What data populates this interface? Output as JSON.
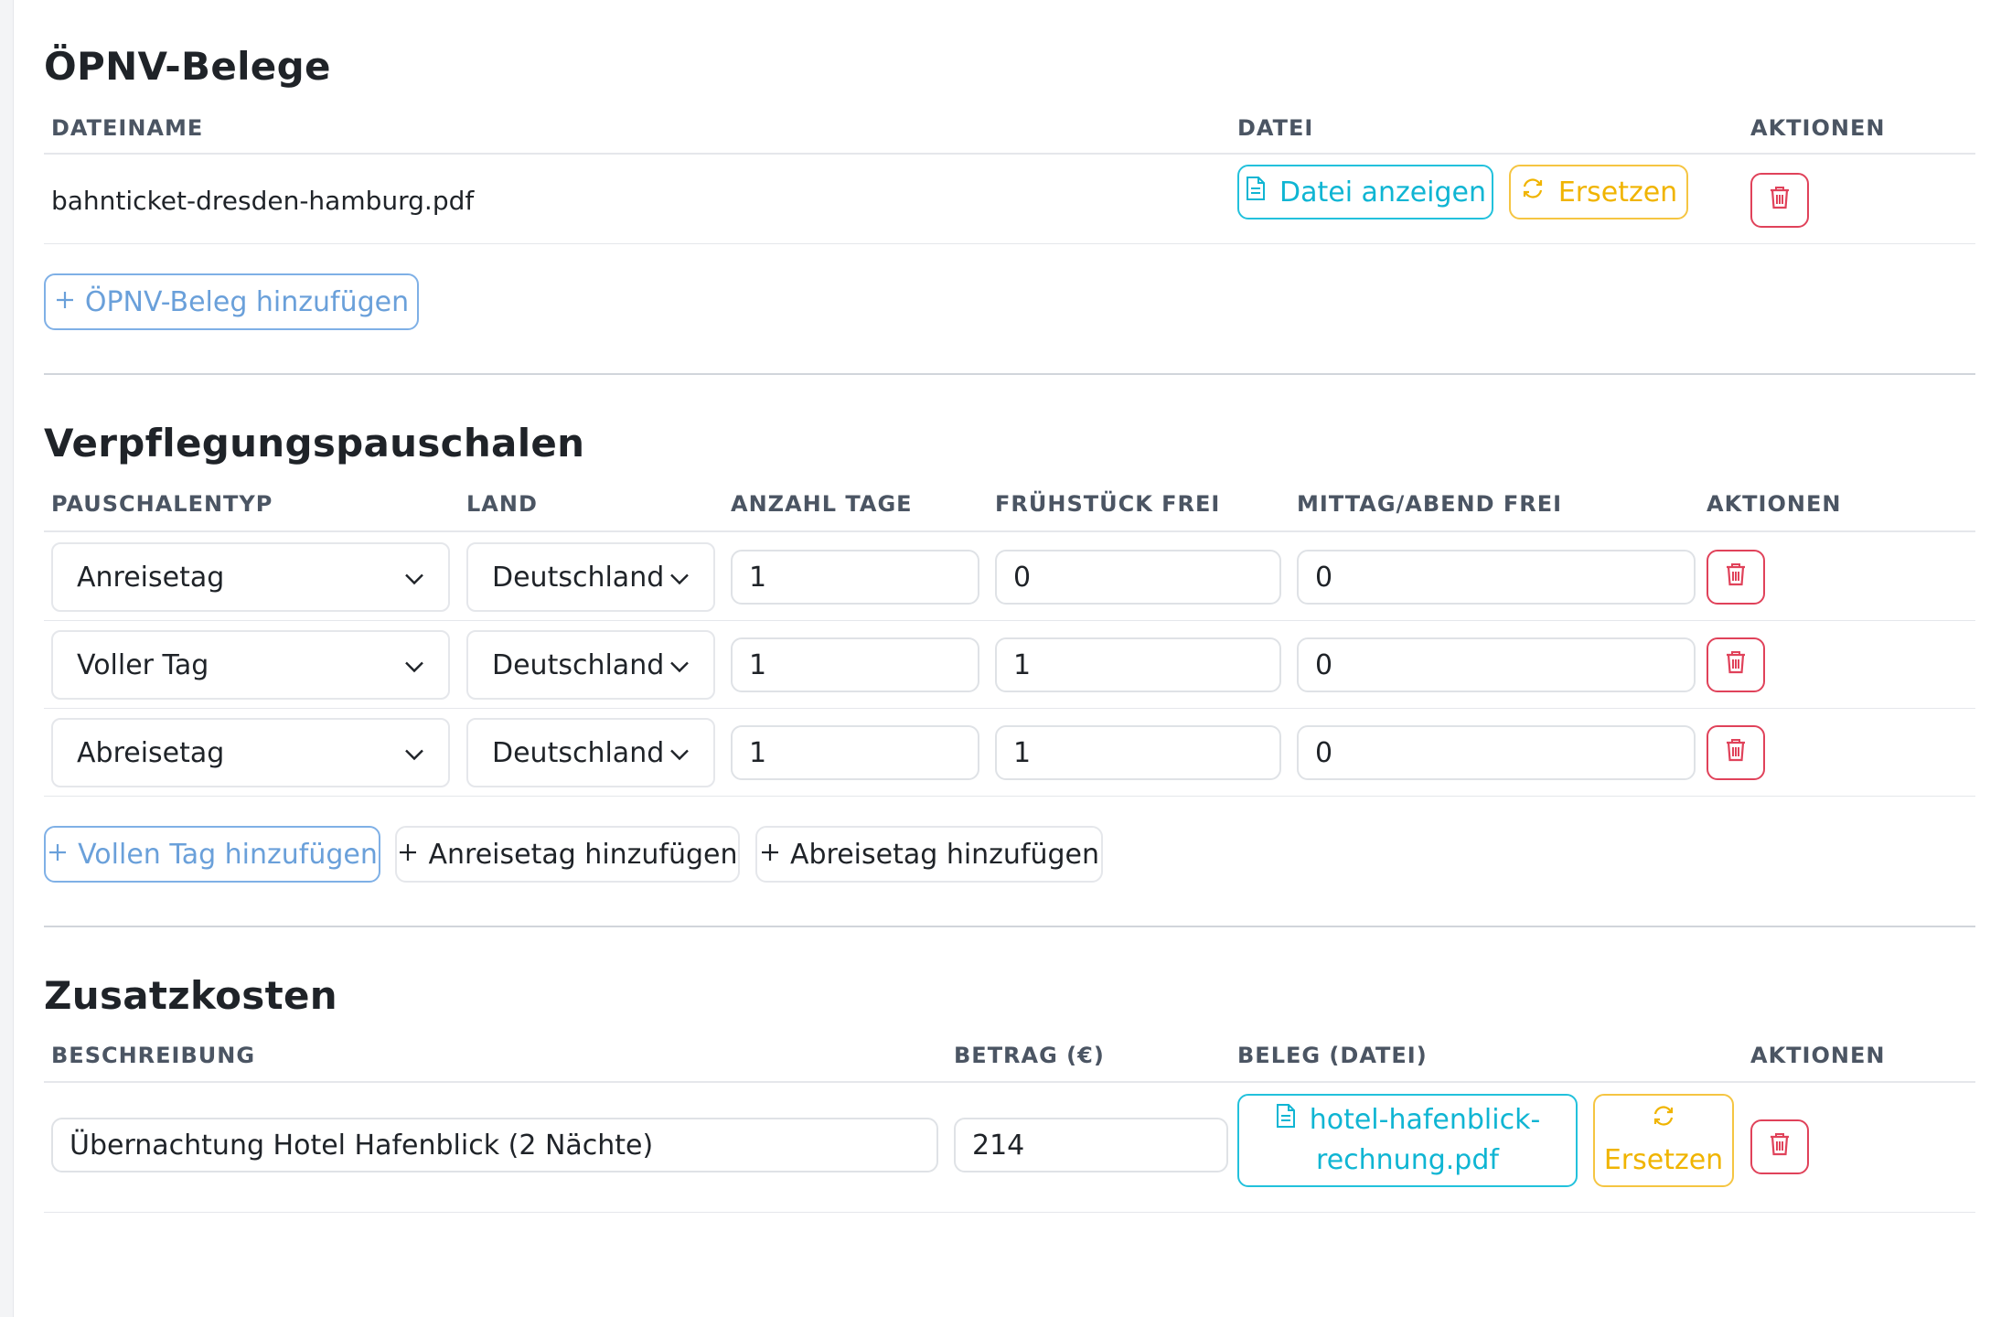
{
  "opnv": {
    "title": "ÖPNV-Belege",
    "headers": {
      "filename": "DATEINAME",
      "file": "DATEI",
      "actions": "AKTIONEN"
    },
    "rows": [
      {
        "filename": "bahnticket-dresden-hamburg.pdf",
        "view_label": "Datei anzeigen",
        "replace_label": "Ersetzen"
      }
    ],
    "add_label": "ÖPNV-Beleg hinzufügen"
  },
  "meals": {
    "title": "Verpflegungspauschalen",
    "headers": {
      "type": "PAUSCHALENTYP",
      "country": "LAND",
      "days": "ANZAHL TAGE",
      "breakfast": "FRÜHSTÜCK FREI",
      "lunch_dinner": "MITTAG/ABEND FREI",
      "actions": "AKTIONEN"
    },
    "rows": [
      {
        "type": "Anreisetag",
        "country": "Deutschland",
        "days": "1",
        "breakfast": "0",
        "lunch_dinner": "0"
      },
      {
        "type": "Voller Tag",
        "country": "Deutschland",
        "days": "1",
        "breakfast": "1",
        "lunch_dinner": "0"
      },
      {
        "type": "Abreisetag",
        "country": "Deutschland",
        "days": "1",
        "breakfast": "1",
        "lunch_dinner": "0"
      }
    ],
    "add_full_day": "Vollen Tag hinzufügen",
    "add_arrival": "Anreisetag hinzufügen",
    "add_departure": "Abreisetag hinzufügen"
  },
  "extra": {
    "title": "Zusatzkosten",
    "headers": {
      "description": "BESCHREIBUNG",
      "amount": "BETRAG (€)",
      "receipt": "BELEG (DATEI)",
      "actions": "AKTIONEN"
    },
    "rows": [
      {
        "description": "Übernachtung Hotel Hafenblick (2 Nächte)",
        "amount": "214",
        "file_line1": "hotel-hafenblick-",
        "file_line2": "rechnung.pdf",
        "replace_label": "Ersetzen"
      }
    ]
  },
  "colors": {
    "cyan": "#0fb5d3",
    "amber": "#f0b400",
    "red": "#e0425a",
    "blue": "#6aa0da"
  },
  "icons": {
    "file": "document-icon",
    "replace": "refresh-icon",
    "delete": "trash-icon",
    "add": "plus-icon",
    "chevron": "chevron-down-icon"
  }
}
